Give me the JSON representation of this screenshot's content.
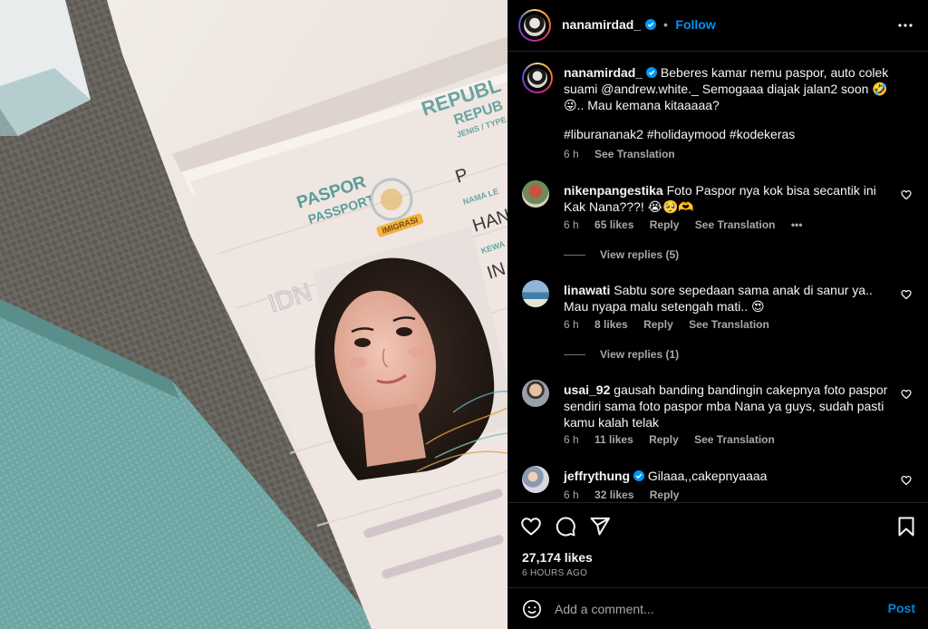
{
  "post_header": {
    "username": "nanamirdad_",
    "separator": "•",
    "follow_label": "Follow"
  },
  "photo": {
    "passport_title_id": "PASPOR",
    "passport_title_en": "PASSPORT",
    "republic_text": "REPUBL",
    "republic_text_2": "REPUB",
    "imigrasi": "IMIGRASI",
    "country_code": "IDN",
    "nama_label": "NAMA LE",
    "kewar_label": "KEWA",
    "type_label": "JENIS / TYPE",
    "field_p": "P",
    "field_name": "HAN",
    "field_in": "IN"
  },
  "caption": {
    "username": "nanamirdad_",
    "text": "Beberes kamar nemu paspor, auto colek suami @andrew.white._ Semogaaa diajak jalan2 soon 🤣😜.. Mau kemana kitaaaaa?",
    "hashtags": "#liburananak2 #holidaymood #kodekeras",
    "time": "6 h",
    "see_translation": "See Translation"
  },
  "comments": [
    {
      "username": "nikenpangestika",
      "text": "Foto Paspor nya kok bisa secantik ini Kak Nana???! 😭🥺🫶",
      "time": "6 h",
      "likes": "65 likes",
      "reply": "Reply",
      "see_translation": "See Translation",
      "more": "•••",
      "view_replies": "View replies (5)"
    },
    {
      "username": "linawati",
      "text": "Sabtu sore sepedaan sama anak di sanur ya.. Mau nyapa malu setengah mati.. 😍",
      "time": "6 h",
      "likes": "8 likes",
      "reply": "Reply",
      "see_translation": "See Translation",
      "view_replies": "View replies (1)"
    },
    {
      "username": "usai_92",
      "text": "gausah banding bandingin cakepnya foto paspor sendiri sama foto paspor mba Nana ya guys, sudah pasti kamu kalah telak",
      "time": "6 h",
      "likes": "11 likes",
      "reply": "Reply",
      "see_translation": "See Translation"
    },
    {
      "username": "jeffrythung",
      "text": "Gilaaa,,cakepnyaaaa",
      "time": "6 h",
      "likes": "32 likes",
      "reply": "Reply"
    }
  ],
  "actions": {
    "likes": "27,174 likes",
    "time_ago": "6 HOURS AGO"
  },
  "add_comment": {
    "placeholder": "Add a comment...",
    "post_label": "Post"
  },
  "colors": {
    "accent": "#0095f6",
    "background": "#000000",
    "muted": "#a8a8a8",
    "divider": "#262626"
  },
  "icons": [
    "more-options-icon",
    "verified-badge-icon",
    "heart-icon",
    "comment-icon",
    "share-icon",
    "bookmark-icon",
    "emoji-icon"
  ]
}
